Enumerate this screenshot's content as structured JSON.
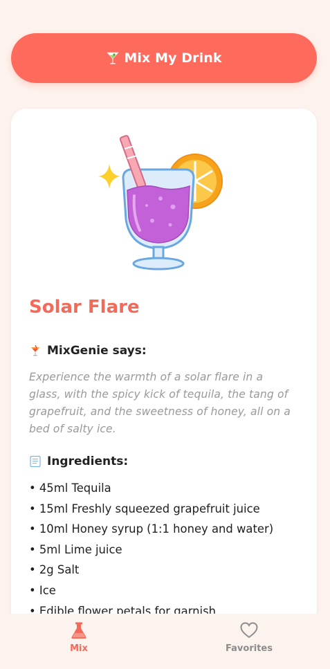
{
  "actions": {
    "mix_button_label": "Mix My Drink",
    "mix_button_icon": "cocktail-glass-icon"
  },
  "drink": {
    "name": "Solar Flare",
    "illustration": "cocktail-glass-with-orange-slice",
    "says_label": "MixGenie says:",
    "says_icon": "tropical-drink-icon",
    "description": "Experience the warmth of a solar flare in a glass, with the spicy kick of tequila, the tang of grapefruit, and the sweetness of honey, all on a bed of salty ice.",
    "ingredients_label": "Ingredients:",
    "ingredients_icon": "receipt-icon",
    "ingredients": [
      "• 45ml Tequila",
      "• 15ml Freshly squeezed grapefruit juice",
      "• 10ml Honey syrup (1:1 honey and water)",
      "• 5ml Lime juice",
      "• 2g Salt",
      "• Ice",
      "• Edible flower petals for garnish"
    ]
  },
  "tabs": [
    {
      "label": "Mix",
      "icon": "flask-icon",
      "active": true
    },
    {
      "label": "Favorites",
      "icon": "heart-icon",
      "active": false
    }
  ],
  "colors": {
    "accent": "#fe6b5d",
    "title": "#f26a5a",
    "background": "#fdf3ee",
    "inactive": "#8c8c8c"
  }
}
